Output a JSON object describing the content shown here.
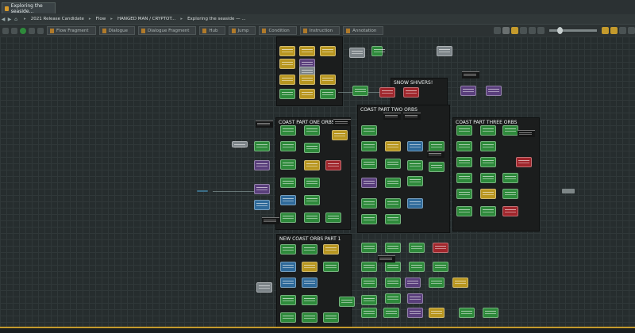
{
  "document_tab": {
    "label": "Exploring the seaside..."
  },
  "breadcrumbs": [
    "2021 Release Candidate",
    "Flow",
    "HANGED MAN / CRYPTOT...",
    "Exploring the seaside — ..."
  ],
  "toolbar": {
    "objects": [
      "Flow Fragment",
      "Dialogue",
      "Dialogue Fragment",
      "Hub",
      "Jump",
      "Condition",
      "Instruction",
      "Annotation"
    ]
  },
  "canvas": {
    "groups": [
      {
        "title": "SNOW SHIVERS!"
      },
      {
        "title": "COAST PART TWO ORBS"
      },
      {
        "title": "COAST PART ONE ORBS"
      },
      {
        "title": "COAST PART THREE ORBS"
      },
      {
        "title": "NEW COAST ORBS PART 1"
      }
    ]
  },
  "colors": {
    "accent": "#c49a2c",
    "green_node": "#2e8a3b",
    "yellow_node": "#b89620",
    "purple_node": "#5a3f7c",
    "blue_node": "#2f6a9a",
    "red_node": "#a0262c"
  }
}
